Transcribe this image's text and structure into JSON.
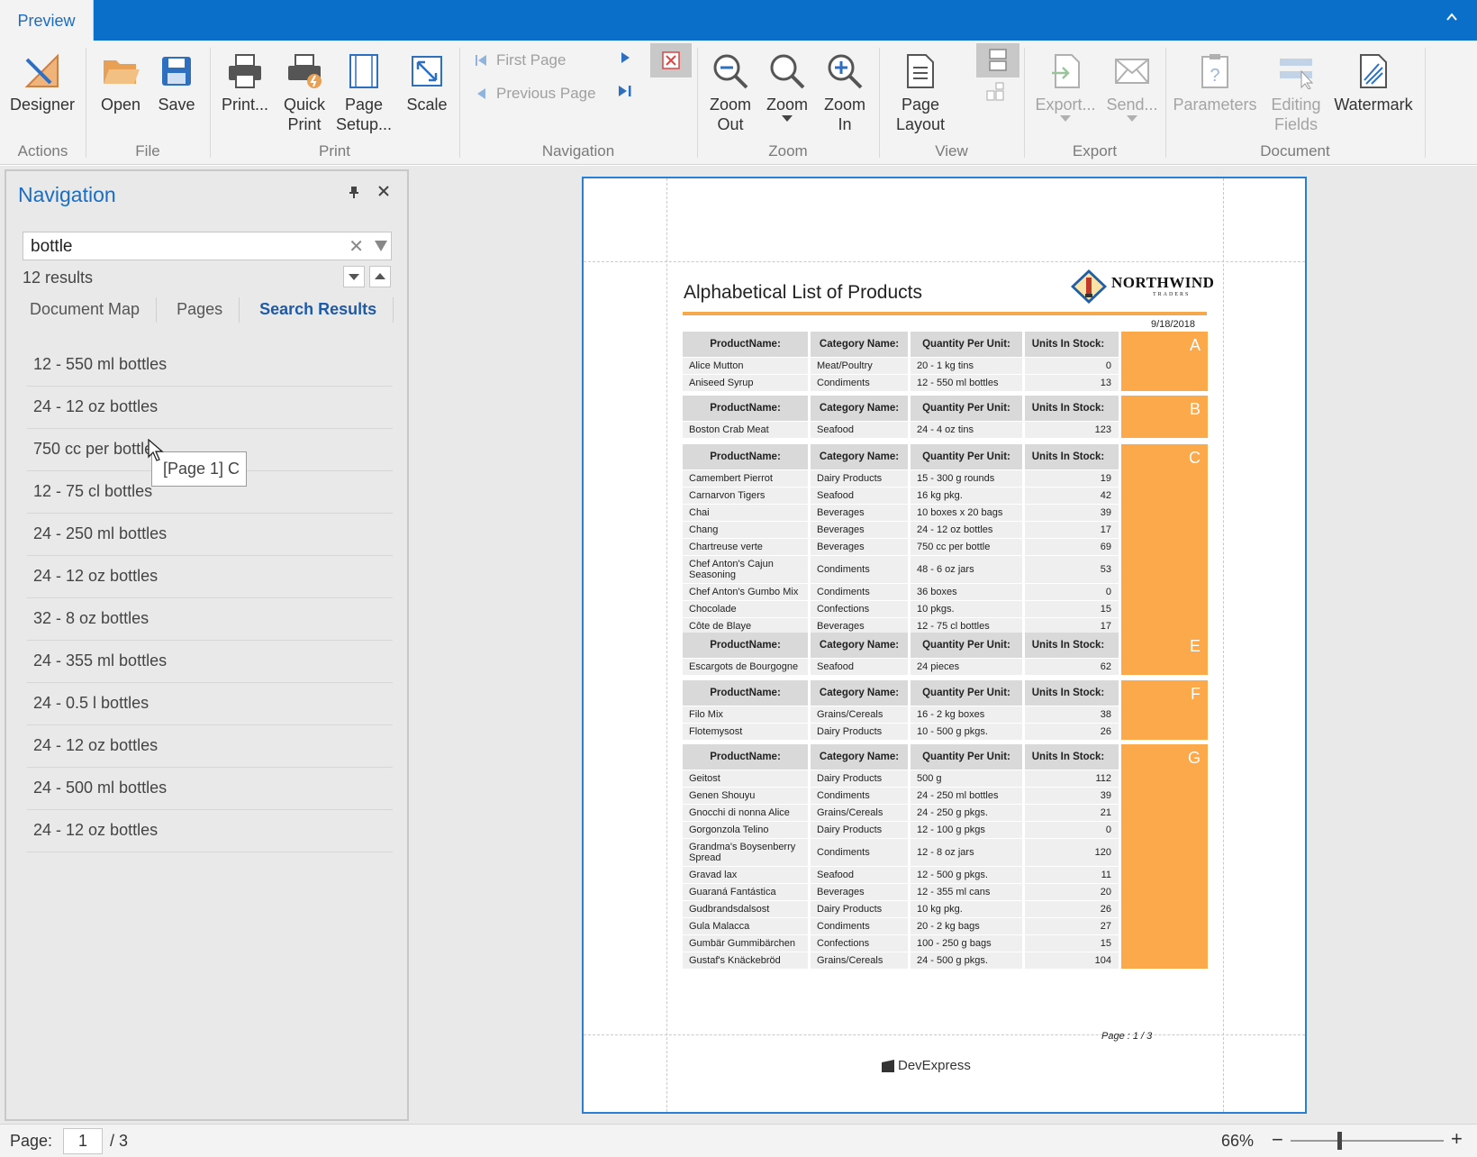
{
  "titlebar": {
    "tab": "Preview"
  },
  "ribbon": {
    "designer": "Designer",
    "open": "Open",
    "save": "Save",
    "print": "Print...",
    "quick_print": [
      "Quick",
      "Print"
    ],
    "page_setup": [
      "Page",
      "Setup..."
    ],
    "scale": "Scale",
    "first_page": "First Page",
    "previous_page": "Previous Page",
    "zoom_out": [
      "Zoom",
      "Out"
    ],
    "zoom": "Zoom",
    "zoom_in": [
      "Zoom",
      "In"
    ],
    "page_layout": [
      "Page",
      "Layout"
    ],
    "export": "Export...",
    "send": "Send...",
    "parameters": "Parameters",
    "editing_fields": [
      "Editing",
      "Fields"
    ],
    "watermark": "Watermark",
    "groups": {
      "actions": "Actions",
      "file": "File",
      "print": "Print",
      "navigation": "Navigation",
      "zoom": "Zoom",
      "view": "View",
      "export": "Export",
      "document": "Document"
    }
  },
  "navigation": {
    "title": "Navigation",
    "search_value": "bottle",
    "results_count": "12 results",
    "tabs": [
      "Document Map",
      "Pages",
      "Search Results"
    ],
    "active_tab": "Search Results",
    "results": [
      "12 - 550 ml bottles",
      "24 - 12 oz bottles",
      "750 cc per bottle",
      "12 - 75 cl bottles",
      "24 - 250 ml bottles",
      "24 - 12 oz bottles",
      "32 - 8 oz bottles",
      "24 - 355 ml bottles",
      "24 - 0.5 l bottles",
      "24 - 12 oz bottles",
      "24 - 500 ml bottles",
      "24 - 12 oz bottles"
    ],
    "tooltip": "[Page 1] C"
  },
  "report": {
    "title": "Alphabetical List of Products",
    "logo_text": "NORTHWIND",
    "logo_sub": "TRADERS",
    "date": "9/18/2018",
    "headers": [
      "ProductName:",
      "Category Name:",
      "Quantity Per Unit:",
      "Units In Stock:"
    ],
    "groups": [
      {
        "letter": "A",
        "rows": [
          [
            "Alice Mutton",
            "Meat/Poultry",
            "20 - 1 kg tins",
            "0"
          ],
          [
            "Aniseed Syrup",
            "Condiments",
            "12 - 550 ml bottles",
            "13"
          ]
        ]
      },
      {
        "letter": "B",
        "rows": [
          [
            "Boston Crab Meat",
            "Seafood",
            "24 - 4 oz tins",
            "123"
          ]
        ]
      },
      {
        "letter": "C",
        "rows": [
          [
            "Camembert Pierrot",
            "Dairy Products",
            "15 - 300 g rounds",
            "19"
          ],
          [
            "Carnarvon Tigers",
            "Seafood",
            "16 kg pkg.",
            "42"
          ],
          [
            "Chai",
            "Beverages",
            "10 boxes x 20 bags",
            "39"
          ],
          [
            "Chang",
            "Beverages",
            "24 - 12 oz bottles",
            "17"
          ],
          [
            "Chartreuse verte",
            "Beverages",
            "750 cc per bottle",
            "69"
          ],
          [
            "Chef Anton's Cajun Seasoning",
            "Condiments",
            "48 - 6 oz jars",
            "53"
          ],
          [
            "Chef Anton's Gumbo Mix",
            "Condiments",
            "36 boxes",
            "0"
          ],
          [
            "Chocolade",
            "Confections",
            "10 pkgs.",
            "15"
          ],
          [
            "Côte de Blaye",
            "Beverages",
            "12 - 75 cl bottles",
            "17"
          ]
        ]
      },
      {
        "letter": "E",
        "rows": [
          [
            "Escargots de Bourgogne",
            "Seafood",
            "24 pieces",
            "62"
          ]
        ]
      },
      {
        "letter": "F",
        "rows": [
          [
            "Filo Mix",
            "Grains/Cereals",
            "16 - 2 kg boxes",
            "38"
          ],
          [
            "Flotemysost",
            "Dairy Products",
            "10 - 500 g pkgs.",
            "26"
          ]
        ]
      },
      {
        "letter": "G",
        "rows": [
          [
            "Geitost",
            "Dairy Products",
            "500 g",
            "112"
          ],
          [
            "Genen Shouyu",
            "Condiments",
            "24 - 250 ml bottles",
            "39"
          ],
          [
            "Gnocchi di nonna Alice",
            "Grains/Cereals",
            "24 - 250 g pkgs.",
            "21"
          ],
          [
            "Gorgonzola Telino",
            "Dairy Products",
            "12 - 100 g pkgs",
            "0"
          ],
          [
            "Grandma's Boysenberry Spread",
            "Condiments",
            "12 - 8 oz jars",
            "120"
          ],
          [
            "Gravad lax",
            "Seafood",
            "12 - 500 g pkgs.",
            "11"
          ],
          [
            "Guaraná Fantástica",
            "Beverages",
            "12 - 355 ml cans",
            "20"
          ],
          [
            "Gudbrandsdalsost",
            "Dairy Products",
            "10 kg pkg.",
            "26"
          ],
          [
            "Gula Malacca",
            "Condiments",
            "20 - 2 kg bags",
            "27"
          ],
          [
            "Gumbär Gummibärchen",
            "Confections",
            "100 - 250 g bags",
            "15"
          ],
          [
            "Gustaf's Knäckebröd",
            "Grains/Cereals",
            "24 - 500 g pkgs.",
            "104"
          ]
        ]
      }
    ],
    "page_footer": "Page : 1 / 3",
    "brand": "DevExpress"
  },
  "status": {
    "page_label": "Page:",
    "page_value": "1",
    "page_total": "/ 3",
    "zoom": "66%"
  },
  "colors": {
    "accent": "#0a6fc8",
    "group_band": "#fba94b",
    "rule": "#f7a84c"
  }
}
